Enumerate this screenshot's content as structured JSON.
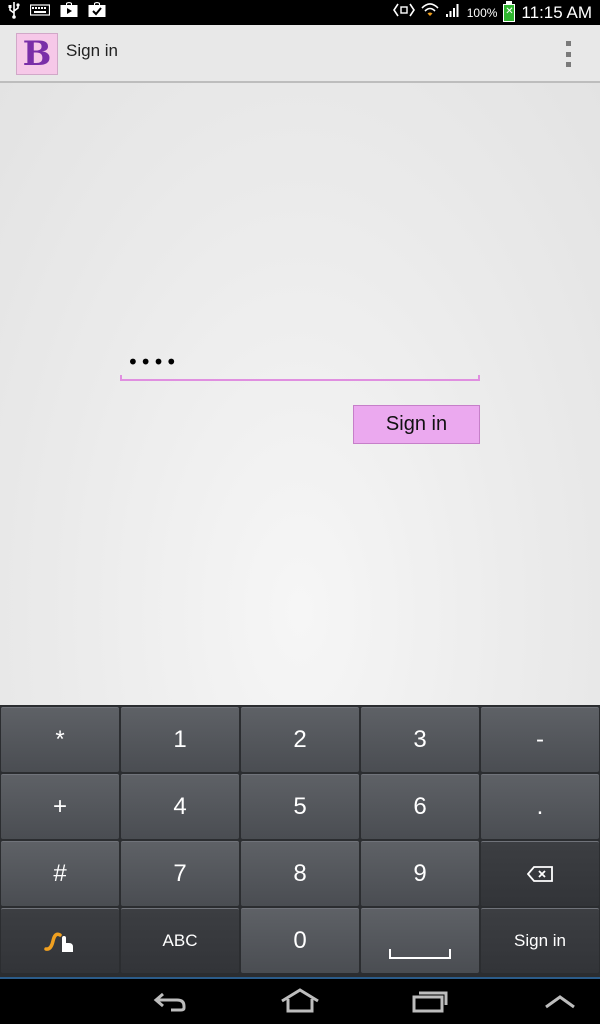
{
  "status_bar": {
    "battery_percent": "100%",
    "time": "11:15 AM",
    "icons": [
      "usb-icon",
      "keyboard-icon",
      "play-store-icon",
      "task-icon",
      "nfc-icon",
      "wifi-icon",
      "signal-icon",
      "battery-icon"
    ]
  },
  "action_bar": {
    "logo_letter": "B",
    "title": "Sign in",
    "overflow_icon": "overflow-menu-icon"
  },
  "form": {
    "password_value": "••••",
    "signin_label": "Sign in",
    "accent_color": "#e08fe0",
    "button_color": "#eba9ef"
  },
  "keyboard": {
    "rows": [
      [
        "*",
        "1",
        "2",
        "3",
        "-"
      ],
      [
        "+",
        "4",
        "5",
        "6",
        "."
      ],
      [
        "#",
        "7",
        "8",
        "9",
        "backspace"
      ],
      [
        "swype",
        "ABC",
        "0",
        "space",
        "Sign in"
      ]
    ]
  },
  "nav_bar": {
    "icons": [
      "back-icon",
      "home-icon",
      "recent-apps-icon",
      "hide-keyboard-icon"
    ]
  }
}
